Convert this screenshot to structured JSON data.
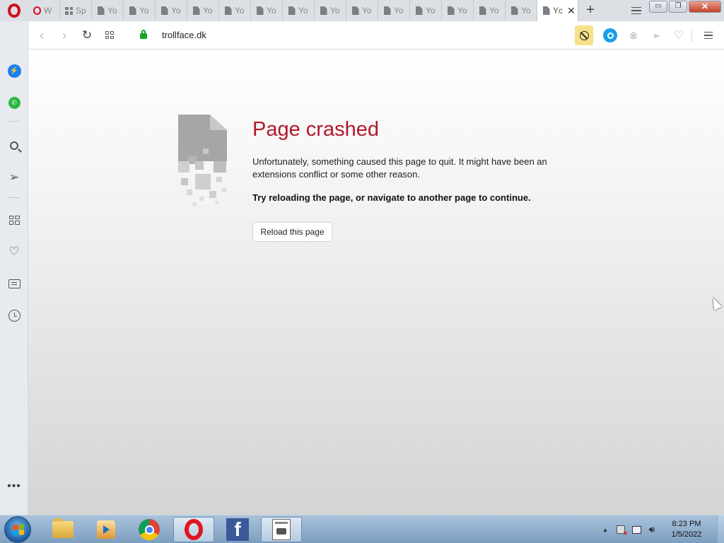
{
  "browser": {
    "tabs": [
      {
        "label": "W",
        "icon": "opera-icon"
      },
      {
        "label": "Sp",
        "icon": "speed-dial-icon"
      },
      {
        "label": "Yo",
        "icon": "document-icon"
      },
      {
        "label": "Yo",
        "icon": "document-icon"
      },
      {
        "label": "Yo",
        "icon": "document-icon"
      },
      {
        "label": "Yo",
        "icon": "document-icon"
      },
      {
        "label": "Yo",
        "icon": "document-icon"
      },
      {
        "label": "Yo",
        "icon": "document-icon"
      },
      {
        "label": "Yo",
        "icon": "document-icon"
      },
      {
        "label": "Yo",
        "icon": "document-icon"
      },
      {
        "label": "Yo",
        "icon": "document-icon"
      },
      {
        "label": "Yo",
        "icon": "document-icon"
      },
      {
        "label": "Yo",
        "icon": "document-icon"
      },
      {
        "label": "Yo",
        "icon": "document-icon"
      },
      {
        "label": "Yo",
        "icon": "document-icon"
      },
      {
        "label": "Yo",
        "icon": "document-icon"
      }
    ],
    "active_tab": {
      "label": "Yc",
      "icon": "document-icon"
    },
    "new_tab_label": "+",
    "window_buttons": {
      "minimize": "▭",
      "maximize": "❐",
      "close": "✕"
    }
  },
  "address_bar": {
    "url": "trollface.dk",
    "secure": true,
    "icons": [
      "back-icon",
      "forward-icon",
      "reload-icon",
      "tabs-grid-icon",
      "lock-icon",
      "adblock-icon",
      "snapshot-icon",
      "tracker-blocker-icon",
      "my-flow-icon",
      "bookmark-heart-icon",
      "easy-setup-icon"
    ]
  },
  "sidebar": {
    "items": [
      "messenger-icon",
      "whatsapp-icon",
      "search-icon",
      "my-flow-icon",
      "speed-dial-icon",
      "bookmarks-icon",
      "news-icon",
      "history-icon",
      "more-icon"
    ],
    "more_label": "•••"
  },
  "crash_page": {
    "title": "Page crashed",
    "message": "Unfortunately, something caused this page to quit. It might have been an extensions conflict or some other reason.",
    "hint": "Try reloading the page, or navigate to another page to continue.",
    "reload_button": "Reload this page",
    "title_color": "#b3182a"
  },
  "taskbar": {
    "pinned": [
      "windows-explorer-icon",
      "media-center-icon",
      "chrome-icon",
      "opera-icon",
      "facebook-icon",
      "app-icon"
    ],
    "active": "opera-icon",
    "facebook_label": "f",
    "clock": {
      "time": "8:23 PM",
      "date": "1/5/2022"
    }
  }
}
